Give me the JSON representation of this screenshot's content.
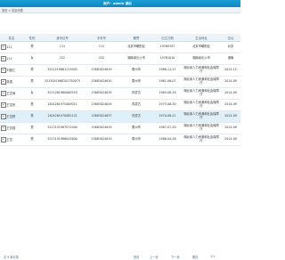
{
  "header": {
    "user_label": "用户：admin  退出"
  },
  "breadcrumb": {
    "text": "首页 > 信息列表"
  },
  "table": {
    "columns": [
      "姓名",
      "性别",
      "身份证号",
      "手机号",
      "籍贯",
      "出生日期",
      "生活地址",
      "住址"
    ],
    "rows": [
      {
        "name": "111",
        "sex": "男",
        "idcard": "111",
        "phone": "111",
        "origin": "北京市朝阳区",
        "birth": "19760707",
        "addr": "北京市朝阳区",
        "addr2": "北京"
      },
      {
        "name": "111",
        "sex": "女",
        "idcard": "222",
        "phone": "222",
        "origin": "湖南省长沙市",
        "birth": "19781010",
        "addr": "湖南省长沙市",
        "addr2": "湖南"
      },
      {
        "name": "刘德江",
        "sex": "男",
        "idcard": "3222219861213005",
        "phone": "13683024619",
        "origin": "泰州市",
        "birth": "1986-12-27",
        "addr": "湖北省人力资源和社会保障厅",
        "addr2": "2015-12"
      },
      {
        "name": "张强",
        "sex": "男",
        "idcard": "3213051968102750075",
        "phone": "13683024610",
        "origin": "泰州市",
        "birth": "1961-06-07",
        "addr": "湖北省人力资源和社会保障厅",
        "addr2": "2014-09"
      },
      {
        "name": "王富涛",
        "sex": "女",
        "idcard": "3211261960060519",
        "phone": "13683024619",
        "origin": "内蒙古",
        "birth": "1963-08-29",
        "addr": "湖北省人力资源和社会保障厅",
        "addr2": "2014-09"
      },
      {
        "name": "王富贵",
        "sex": "男",
        "idcard": "1504261975063011",
        "phone": "13683024619",
        "origin": "内蒙古",
        "birth": "1975-06-30",
        "addr": "湖北省人力资源和社会保障厅",
        "addr2": "2014-09"
      },
      {
        "name": "王富财",
        "sex": "男",
        "idcard": "1404261970082121",
        "phone": "13683024637",
        "origin": "内蒙古",
        "birth": "1970-08-21",
        "addr": "湖北省人力资源和社会保障厅",
        "addr2": "2014-09",
        "highlight": true
      },
      {
        "name": "王富强",
        "sex": "男",
        "idcard": "3213151987072000",
        "phone": "13683024619",
        "origin": "泰州市",
        "birth": "1987-07-20",
        "addr": "湖北省人力资源和社会保障厅",
        "addr2": "2014-09"
      },
      {
        "name": "王富",
        "sex": "男",
        "idcard": "3213151986042600",
        "phone": "13683024619",
        "origin": "泰州市",
        "birth": "1986-04-26",
        "addr": "湖北省人力资源和社会保障厅",
        "addr2": "2014-09"
      }
    ]
  },
  "pager": {
    "info": "共 9 条记录",
    "first": "首页",
    "prev": "上一页",
    "next": "下一页",
    "last": "尾页",
    "page": "1/1"
  }
}
